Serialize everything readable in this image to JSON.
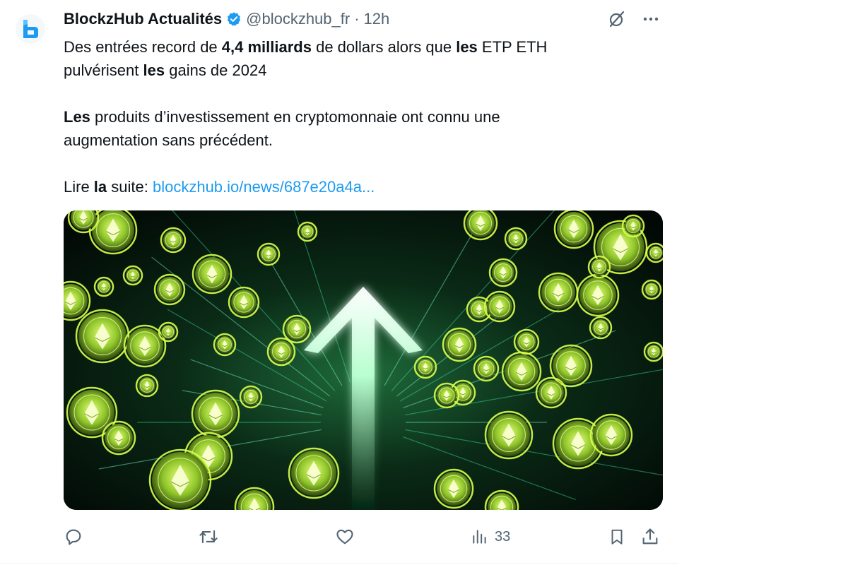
{
  "tweet": {
    "author_name": "BlockzHub Actualités",
    "handle": "@blockzhub_fr",
    "separator": "·",
    "time": "12h",
    "avatar_icon": "blockzhub-logo-icon",
    "verified_icon": "verified-badge-icon",
    "more_icon": "more-horizontal-icon",
    "grok_icon": "grok-slash-circle-icon",
    "body": {
      "line1_p1": "Des entrées record de ",
      "line1_b1": "4,4 milliards",
      "line1_p2": " de dollars alors que ",
      "line1_b2": "les",
      "line1_p3": " ETP ETH",
      "line2_p1": "pulvérisent ",
      "line2_b1": "les",
      "line2_p2": " gains de 2024",
      "para2_b1": "Les",
      "para2_p1": " produits d’investissement en cryptomonnaie ont connu une",
      "para2_line2": "augmentation sans précédent.",
      "para3_p1": "Lire ",
      "para3_b1": "la",
      "para3_p2": " suite: ",
      "link": "blockzhub.io/news/687e20a4a..."
    },
    "media_alt_icon": "ethereum-coins-upward-arrow-image",
    "colors": {
      "link": "#1d9bf0",
      "secondary": "#536471",
      "verified": "#1d9bf0",
      "coin_glow": "#c6ff3d",
      "arrow_glow": "#7dffb0"
    },
    "actions": {
      "reply_icon": "reply-icon",
      "retweet_icon": "retweet-icon",
      "like_icon": "heart-icon",
      "views_icon": "views-bar-chart-icon",
      "views_count": "33",
      "bookmark_icon": "bookmark-icon",
      "share_icon": "share-icon"
    }
  }
}
